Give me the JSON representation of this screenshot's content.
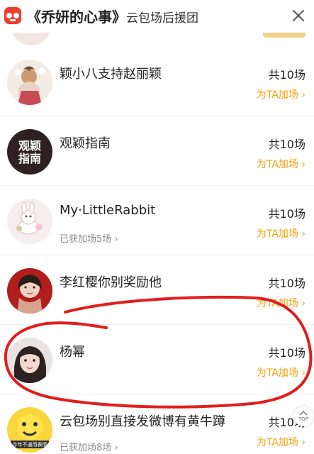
{
  "header": {
    "title": "《乔妍的心事》",
    "subtitle": "云包场后援团"
  },
  "list": [
    {
      "name": "颖小八支持赵丽颖",
      "count": "共10场",
      "boost": "为TA加场",
      "earned": ""
    },
    {
      "name": "观颖指南",
      "count": "共10场",
      "boost": "为TA加场",
      "earned": ""
    },
    {
      "name": "My·LittleRabbit",
      "count": "共10场",
      "boost": "为TA加场",
      "earned": "已获加场5场"
    },
    {
      "name": "李红樱你别奖励他",
      "count": "共10场",
      "boost": "为TA加场",
      "earned": ""
    },
    {
      "name": "杨幂",
      "count": "共10场",
      "boost": "为TA加场",
      "earned": ""
    },
    {
      "name": "云包场别直接发微博有黄牛蹲",
      "count": "共10场",
      "boost": "为TA加场",
      "earned": "已获加场8场"
    }
  ],
  "avatars": {
    "item_2": "观颖指南",
    "item_6": "今年不通用表情"
  },
  "ui": {
    "top_button": "TOP"
  },
  "colors": {
    "accent": "#f3a10a",
    "annotation": "#e11d1d",
    "logo": "#ef3b2c"
  }
}
